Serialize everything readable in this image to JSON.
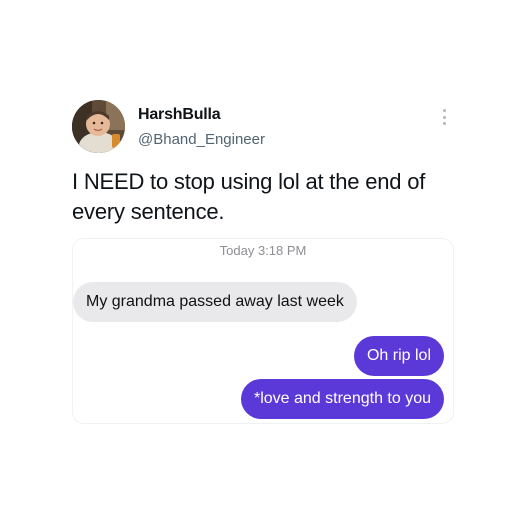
{
  "tweet": {
    "display_name": "HarshBulla",
    "handle": "@Bhand_Engineer",
    "text": "I NEED to stop using lol at the end of every sentence."
  },
  "conversation": {
    "timestamp": "Today 3:18 PM",
    "messages": [
      {
        "direction": "incoming",
        "text": "My grandma passed away last week"
      },
      {
        "direction": "outgoing",
        "text": "Oh rip lol"
      },
      {
        "direction": "outgoing",
        "text": "*love and strength to you"
      }
    ]
  },
  "colors": {
    "outgoing_bubble": "#5b39d9",
    "incoming_bubble": "#e9e9eb",
    "text_primary": "#0f1419",
    "text_secondary": "#536471"
  },
  "icons": {
    "more": "more-vertical-icon",
    "avatar": "profile-avatar"
  }
}
